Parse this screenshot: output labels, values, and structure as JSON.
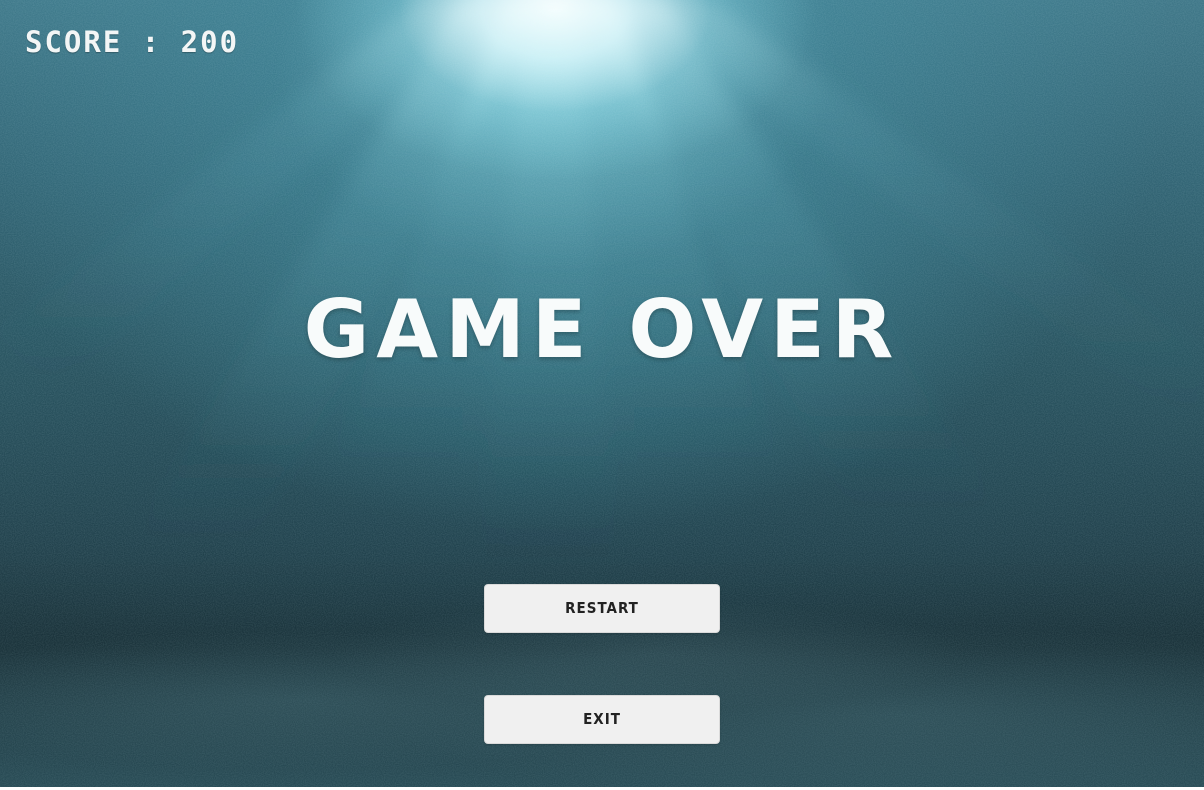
{
  "hud": {
    "score_text": "SCORE : 200"
  },
  "game_over": {
    "title": "GAME OVER"
  },
  "buttons": {
    "restart_label": "RESTART",
    "exit_label": "EXIT"
  },
  "colors": {
    "text": "#f8fbfb",
    "button_background": "#f0f0f0",
    "button_text": "#222222",
    "water_deep": "#1b343c",
    "water_light": "#3f7788"
  }
}
